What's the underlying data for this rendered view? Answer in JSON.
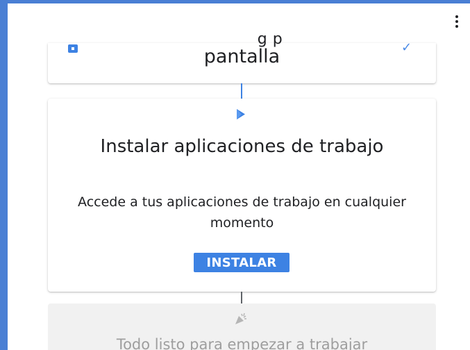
{
  "header": {
    "menu_icon": "more-vert-icon"
  },
  "steps": [
    {
      "icon": "screen-lock-icon",
      "title_partial": "g        p",
      "title": "pantalla",
      "status_icon": "check-icon",
      "status_glyph": "✓",
      "status": "completed"
    },
    {
      "icon": "play-store-icon",
      "title": "Instalar aplicaciones de trabajo",
      "description": "Accede a tus aplicaciones de trabajo en cualquier momento",
      "button_label": "INSTALAR",
      "status": "active"
    },
    {
      "icon": "party-popper-icon",
      "title": "Todo listo para empezar a trabajar",
      "status": "pending"
    }
  ],
  "colors": {
    "accent": "#3d82e3",
    "frame": "#4a7fd4",
    "pending_bg": "#f1f1f1",
    "pending_text": "#9e9e9e"
  }
}
